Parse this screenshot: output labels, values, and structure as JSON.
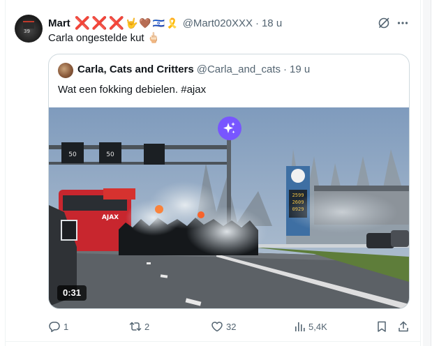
{
  "tweet": {
    "author": {
      "display_name": "Mart",
      "emojis": [
        "❌",
        "❌",
        "❌",
        "🤟",
        "🤎",
        "🇮🇱",
        "🎗️"
      ],
      "handle": "@Mart020XXX",
      "time": "18 u"
    },
    "separator": "·",
    "text": "Carla ongestelde kut 🖕🏻",
    "quoted": {
      "display_name": "Carla, Cats and Critters",
      "handle": "@Carla_and_cats",
      "time": "19 u",
      "text": "Wat een fokking debielen. #ajax",
      "media": {
        "duration": "0:31",
        "sign_speed_left": "50",
        "sign_speed_right": "50",
        "bus_text": "AJAX",
        "fuel_prices": [
          "2599",
          "2609",
          "0929"
        ]
      }
    },
    "actions": {
      "reply_count": "1",
      "repost_count": "2",
      "like_count": "32",
      "views_count": "5,4K"
    }
  },
  "colors": {
    "text_primary": "#0f1419",
    "text_secondary": "#536471",
    "border": "#cfd9de",
    "grok_purple": "#7856ff",
    "red_x": "#e0245e"
  }
}
